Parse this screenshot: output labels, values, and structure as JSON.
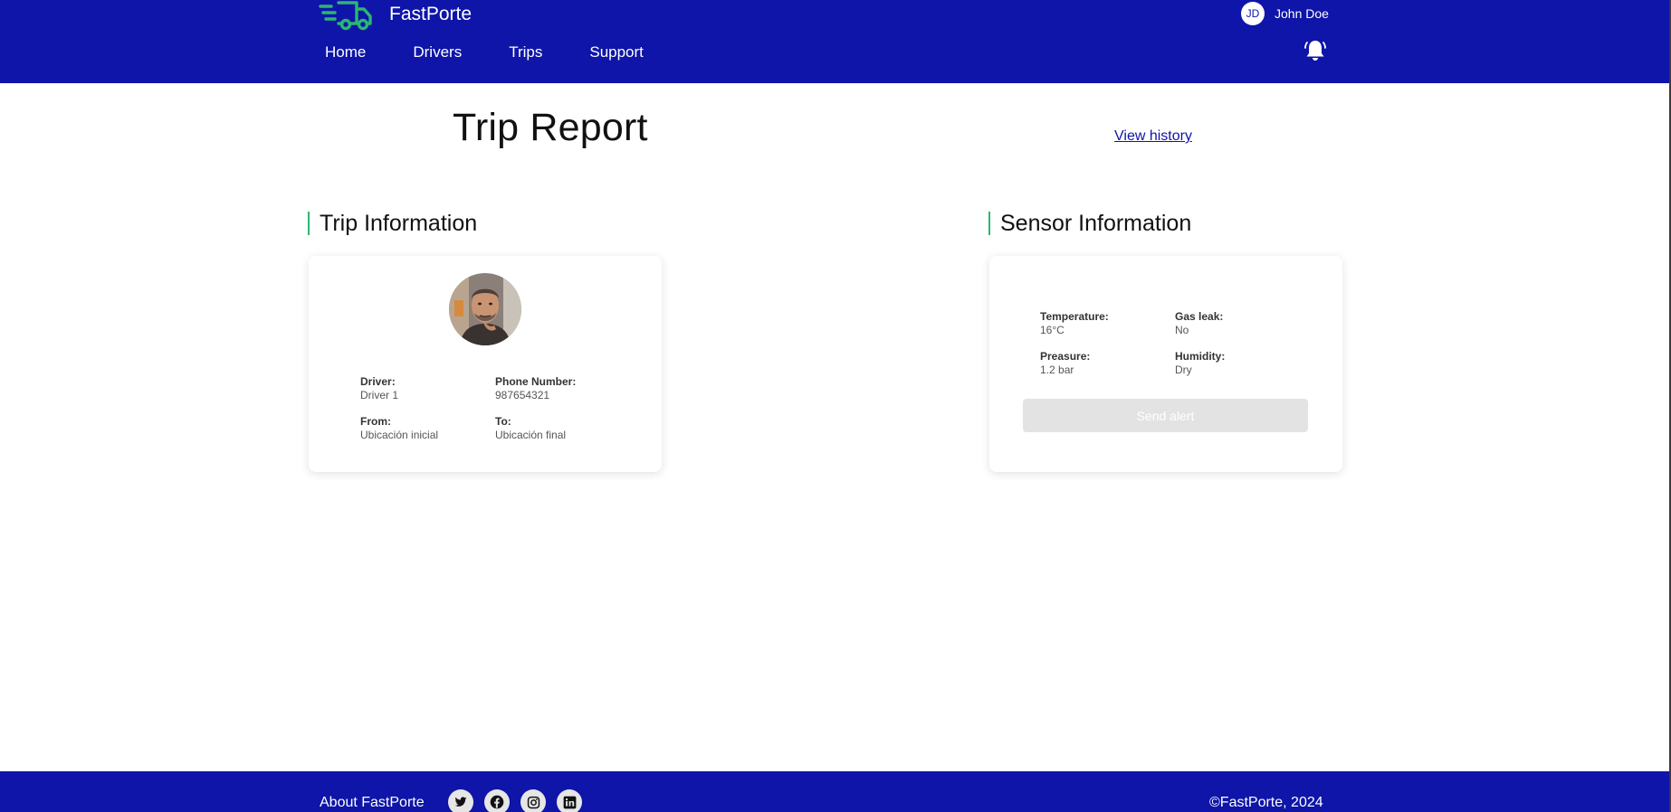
{
  "brand": {
    "name": "FastPorte",
    "logo_icon": "delivery-truck-icon",
    "accent_color": "#2bb673"
  },
  "header": {
    "background_color": "#0e15a8",
    "nav": [
      "Home",
      "Drivers",
      "Trips",
      "Support"
    ],
    "user": {
      "initials": "JD",
      "name": "John Doe"
    },
    "notification_icon": "bell-icon"
  },
  "main": {
    "title": "Trip Report",
    "history_link": "View history",
    "trip_section": {
      "title": "Trip Information",
      "driver_label": "Driver:",
      "driver_value": "Driver 1",
      "phone_label": "Phone Number:",
      "phone_value": "987654321",
      "from_label": "From:",
      "from_value": "Ubicación inicial",
      "to_label": "To:",
      "to_value": "Ubicación final"
    },
    "sensor_section": {
      "title": "Sensor Information",
      "temperature_label": "Temperature:",
      "temperature_value": "16°C",
      "gas_label": "Gas leak:",
      "gas_value": "No",
      "pressure_label": "Preasure:",
      "pressure_value": "1.2 bar",
      "humidity_label": "Humidity:",
      "humidity_value": "Dry",
      "send_alert_label": "Send alert"
    }
  },
  "footer": {
    "about": "About FastPorte",
    "socials": [
      "twitter-icon",
      "facebook-icon",
      "instagram-icon",
      "linkedin-icon"
    ],
    "copyright": "©FastPorte, 2024"
  }
}
